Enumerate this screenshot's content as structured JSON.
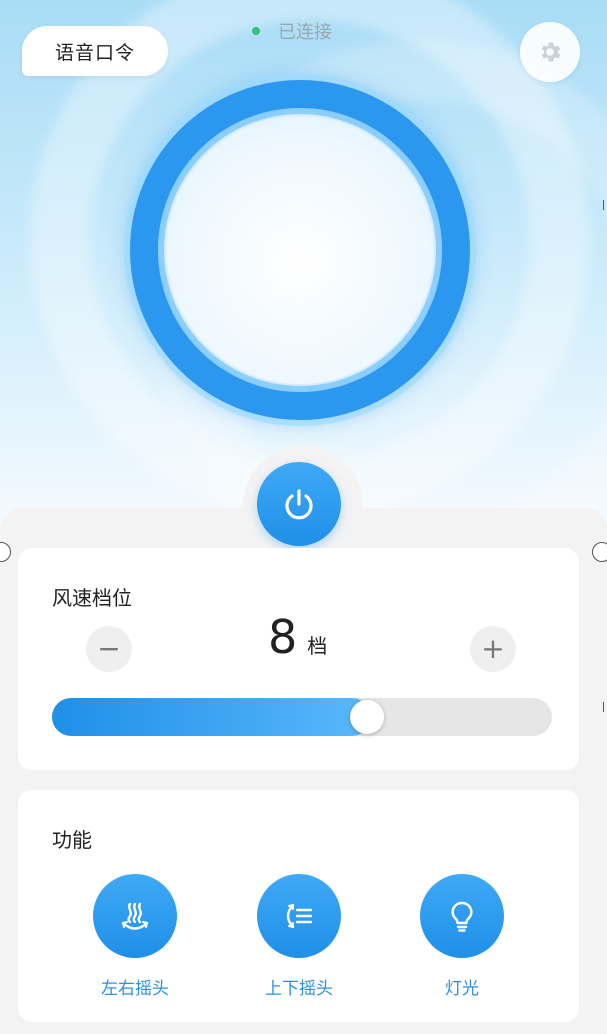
{
  "header": {
    "voice_command_label": "语音口令",
    "status_text": "已连接",
    "status_color": "#2ec27a",
    "settings_icon": "gear-icon"
  },
  "fan": {
    "ring_color": "#2b97ef"
  },
  "power": {
    "icon": "power-icon"
  },
  "speed": {
    "title": "风速档位",
    "value": "8",
    "unit": "档",
    "decrease_label": "−",
    "increase_label": "+",
    "slider_level_fraction": 0.63
  },
  "functions": {
    "title": "功能",
    "items": [
      {
        "label": "左右摇头",
        "icon": "horizontal-swing-icon"
      },
      {
        "label": "上下摇头",
        "icon": "vertical-swing-icon"
      },
      {
        "label": "灯光",
        "icon": "light-bulb-icon"
      }
    ]
  },
  "colors": {
    "accent": "#1f8fe8",
    "accent_light": "#59b8fb",
    "label_blue": "#2b8fe6"
  }
}
